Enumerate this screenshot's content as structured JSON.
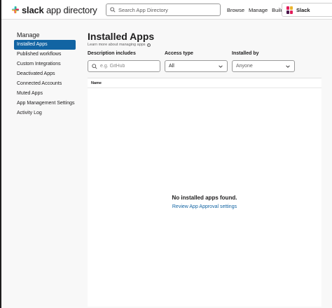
{
  "header": {
    "logo_bold": "slack",
    "logo_rest": " app directory",
    "search_placeholder": "Search App Directory",
    "nav": [
      "Browse",
      "Manage",
      "Build"
    ],
    "workspace": "Slack"
  },
  "sidebar": {
    "title": "Manage",
    "items": [
      {
        "label": "Installed Apps",
        "active": true
      },
      {
        "label": "Published workflows"
      },
      {
        "label": "Custom Integrations"
      },
      {
        "label": "Deactivated Apps"
      },
      {
        "label": "Connected Accounts"
      },
      {
        "label": "Muted Apps"
      },
      {
        "label": "App Management Settings"
      },
      {
        "label": "Activity Log"
      }
    ]
  },
  "main": {
    "title": "Installed Apps",
    "learn_more": "Learn more about managing apps",
    "filters": {
      "description_label": "Description includes",
      "description_placeholder": "e.g. GitHub",
      "access_label": "Access type",
      "access_value": "All",
      "installed_by_label": "Installed by",
      "installed_by_value": "Anyone"
    },
    "table": {
      "column_name": "Name",
      "empty_title": "No installed apps found.",
      "empty_link": "Review App Approval settings"
    }
  },
  "colors": {
    "accent": "#1264a3",
    "text": "#1d1c1d",
    "muted": "#616061",
    "background": "#f8f8f8"
  }
}
